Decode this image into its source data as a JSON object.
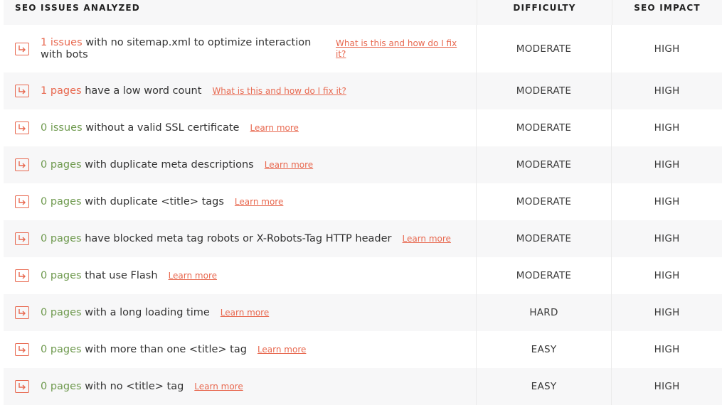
{
  "header": {
    "issues_label": "SEO ISSUES ANALYZED",
    "difficulty_label": "DIFFICULTY",
    "impact_label": "SEO IMPACT"
  },
  "rows": [
    {
      "count": "1 issues",
      "text": "with no sitemap.xml to optimize interaction with bots",
      "link": "What is this and how do I fix it?",
      "difficulty": "MODERATE",
      "impact": "HIGH"
    },
    {
      "count": "1 pages",
      "text": "have a low word count",
      "link": "What is this and how do I fix it?",
      "difficulty": "MODERATE",
      "impact": "HIGH"
    },
    {
      "count": "0 issues",
      "text": "without a valid SSL certificate",
      "link": "Learn more",
      "difficulty": "MODERATE",
      "impact": "HIGH"
    },
    {
      "count": "0 pages",
      "text": "with duplicate meta descriptions",
      "link": "Learn more",
      "difficulty": "MODERATE",
      "impact": "HIGH"
    },
    {
      "count": "0 pages",
      "text": "with duplicate <title> tags",
      "link": "Learn more",
      "difficulty": "MODERATE",
      "impact": "HIGH"
    },
    {
      "count": "0 pages",
      "text": "have blocked meta tag robots or X-Robots-Tag HTTP header",
      "link": "Learn more",
      "difficulty": "MODERATE",
      "impact": "HIGH"
    },
    {
      "count": "0 pages",
      "text": "that use Flash",
      "link": "Learn more",
      "difficulty": "MODERATE",
      "impact": "HIGH"
    },
    {
      "count": "0 pages",
      "text": "with a long loading time",
      "link": "Learn more",
      "difficulty": "HARD",
      "impact": "HIGH"
    },
    {
      "count": "0 pages",
      "text": "with more than one <title> tag",
      "link": "Learn more",
      "difficulty": "EASY",
      "impact": "HIGH"
    },
    {
      "count": "0 pages",
      "text": "with no <title> tag",
      "link": "Learn more",
      "difficulty": "EASY",
      "impact": "HIGH"
    }
  ],
  "colors": {
    "accent": "#e8684f",
    "count_nonzero": "#e8684f",
    "count_zero": "#6f9a4f",
    "row_alt": "#f7f7f8"
  },
  "icons": {
    "row_icon": "redirect-arrow-icon"
  }
}
